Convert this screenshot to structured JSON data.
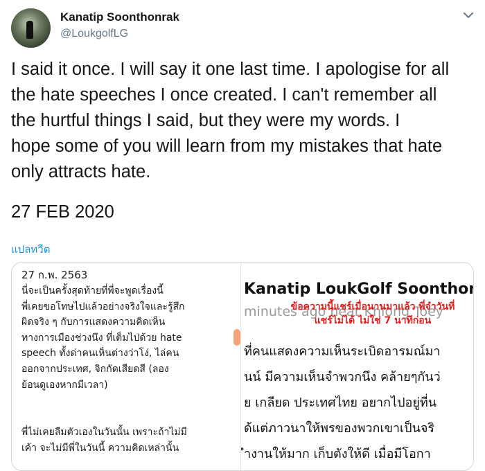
{
  "author": {
    "name": "Kanatip Soonthonrak",
    "handle": "@LoukgolfLG"
  },
  "tweet": {
    "lines": [
      "I said it once. I will say it one last time. I apologise for all",
      "the hate speeches I once created. I can't remember all",
      "the hurtful  things I said, but they were my words. I",
      "hope some of you will learn from my mistakes that hate",
      "only attracts hate."
    ],
    "date": "27 FEB 2020",
    "translate_label": "แปลทวีต"
  },
  "media": {
    "left": {
      "date": "27 ก.พ. 2563",
      "para1": [
        "นี่จะเป็นครั้งสุดท้ายที่พี่จะพูดเรื่องนี้",
        "พี่เคยขอโทษไปแล้วอย่างจริงใจและรู้สึก",
        "ผิดจริง ๆ กับการแสดงความคิดเห็น",
        "ทางการเมืองช่วงนึง ที่เต็มไปด้วย hate",
        "speech ทั้งด่าคนเห็นต่างว่าโง่, ไล่คน",
        "ออกจากประเทศ, จิกกัดเสียดสี (ลอง",
        "ย้อนดูเองหากมีเวลา)"
      ],
      "para2": [
        "พี่ไม่เคยลืมตัวเองในวันนั้น เพราะถ้าไม่มี",
        "เค้า จะไม่มีพี่ในวันนี้ ความคิดเหล่านั้น"
      ]
    },
    "right": {
      "author": "Kanatip LoukGolf Soonthornr",
      "meta": "minutes ago near Khlong Toey",
      "overlay_note": "ข้อความนี้แชร์เมื่อนานมาแล้ว พี่จำวันที่แชร์ไม่ได้ ไม่ใช่ 7 นาทีก่อน",
      "lines": [
        "ที่คนแสดงความเห็นระเบิดอารมณ์มา",
        "นน์ มีความเห็นจำพวกนึง คล้ายๆกันว่",
        "ย เกลียด ประเทศไทย อยากไปอยู่ที่น",
        "ด้แต่ภาวนาให้พรของพวกเขาเป็นจริ",
        "ำงานให้มาก เก็บตังให้ดี เมื่อมีโอกา"
      ]
    }
  },
  "icons": {
    "more": "chevron-down-icon"
  },
  "colors": {
    "link": "#1b95e0",
    "secondary_text": "#657786",
    "overlay_red": "#e0201e"
  }
}
